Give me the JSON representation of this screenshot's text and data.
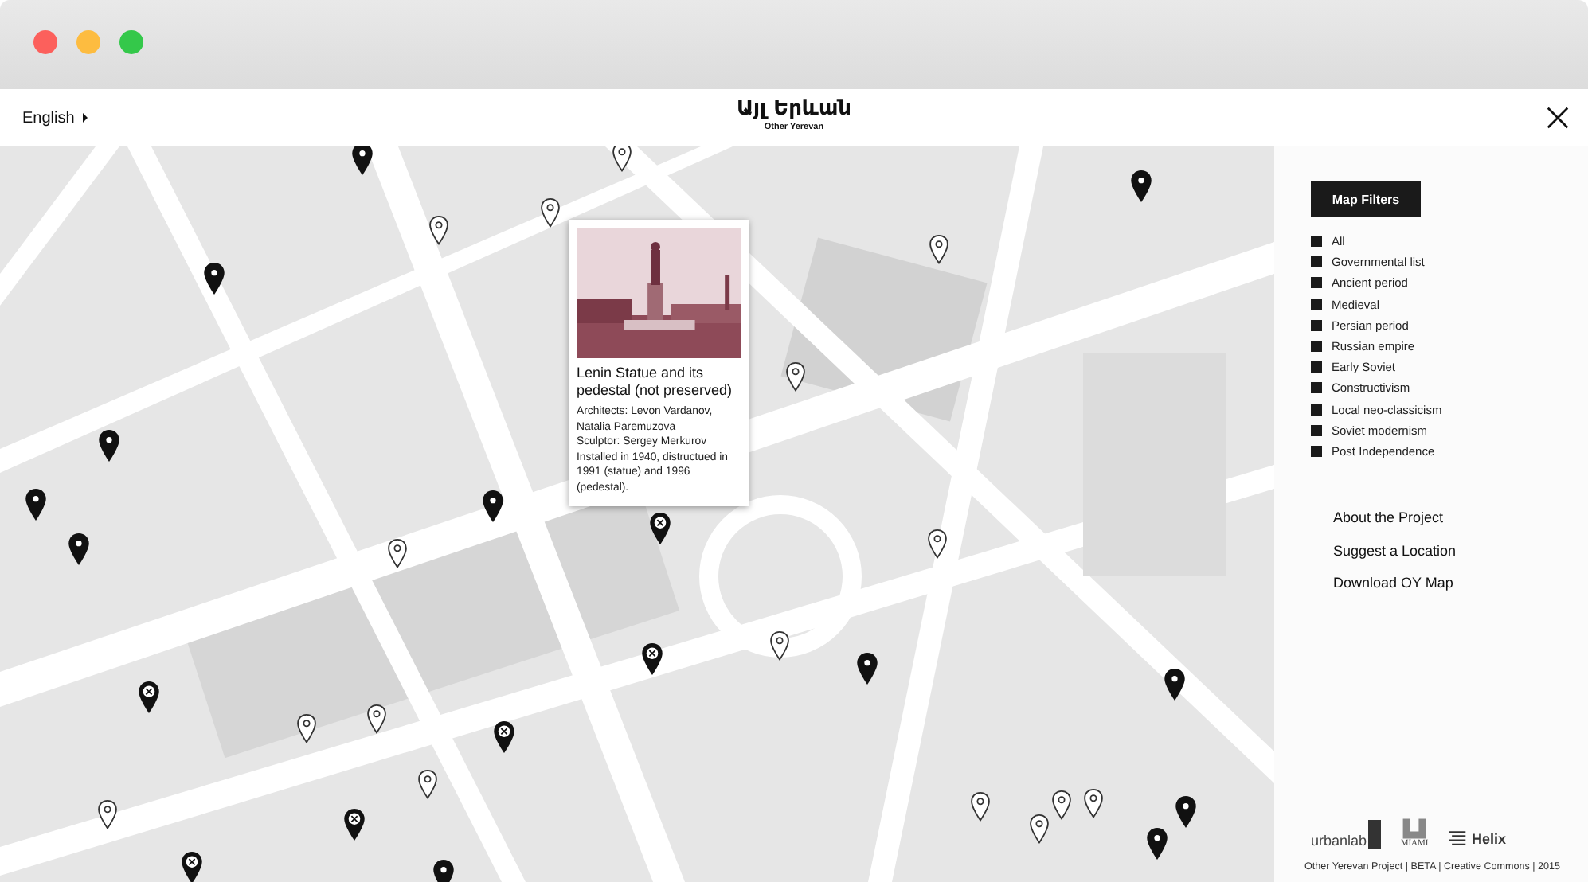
{
  "header": {
    "language": "English",
    "logo": "Այլ Երևան",
    "logo_subtitle": "Other Yerevan"
  },
  "map": {
    "pins": [
      {
        "kind": "filled"
      },
      {
        "kind": "filled"
      },
      {
        "kind": "filled"
      },
      {
        "kind": "filled"
      },
      {
        "kind": "filled"
      },
      {
        "kind": "filled"
      },
      {
        "kind": "filled"
      },
      {
        "kind": "filled"
      },
      {
        "kind": "filled"
      },
      {
        "kind": "filled"
      },
      {
        "kind": "filled"
      },
      {
        "kind": "filled"
      },
      {
        "kind": "outline"
      },
      {
        "kind": "outline"
      },
      {
        "kind": "outline"
      },
      {
        "kind": "outline"
      },
      {
        "kind": "outline"
      },
      {
        "kind": "outline"
      },
      {
        "kind": "outline"
      },
      {
        "kind": "outline"
      },
      {
        "kind": "outline"
      },
      {
        "kind": "outline"
      },
      {
        "kind": "outline"
      },
      {
        "kind": "outline"
      },
      {
        "kind": "outline"
      },
      {
        "kind": "outline"
      },
      {
        "kind": "outline"
      },
      {
        "kind": "outline"
      },
      {
        "kind": "cross"
      },
      {
        "kind": "cross"
      },
      {
        "kind": "cross"
      },
      {
        "kind": "cross"
      },
      {
        "kind": "cross"
      },
      {
        "kind": "cross"
      }
    ],
    "popup": {
      "title": "Lenin Statue and its pedestal (not preserved)",
      "lines": [
        "Architects: Levon Vardanov, Natalia Paremuzova",
        "Sculptor: Sergey Merkurov",
        "Installed in 1940, distructued in 1991 (statue) and 1996 (pedestal)."
      ]
    }
  },
  "sidebar": {
    "filters_button": "Map Filters",
    "filters": [
      {
        "label": "All",
        "checked": true
      },
      {
        "label": "Governmental list",
        "checked": true
      },
      {
        "label": "Ancient period",
        "checked": true
      },
      {
        "label": "Medieval",
        "checked": true
      },
      {
        "label": "Persian period",
        "checked": true
      },
      {
        "label": "Russian empire",
        "checked": true
      },
      {
        "label": "Early Soviet",
        "checked": true
      },
      {
        "label": "Constructivism",
        "checked": true
      },
      {
        "label": "Local neo-classicism",
        "checked": true
      },
      {
        "label": "Soviet modernism",
        "checked": true
      },
      {
        "label": "Post Independence",
        "checked": true
      }
    ],
    "links": [
      "About the Project",
      "Suggest a Location",
      "Download OY Map"
    ],
    "partners": [
      "urbanlab",
      "MIAMI",
      "Helix"
    ],
    "footer": "Other Yerevan Project | BETA | Creative Commons | 2015"
  }
}
